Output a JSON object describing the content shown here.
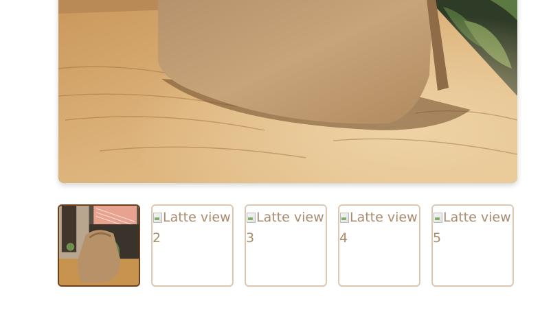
{
  "main_image": {
    "subject": "latte handbag on wooden table"
  },
  "thumbnails": [
    {
      "alt": "",
      "state": "active",
      "loaded": true
    },
    {
      "alt": "Latte view 2",
      "state": "inactive",
      "loaded": false
    },
    {
      "alt": "Latte view 3",
      "state": "inactive",
      "loaded": false
    },
    {
      "alt": "Latte view 4",
      "state": "inactive",
      "loaded": false
    },
    {
      "alt": "Latte view 5",
      "state": "inactive",
      "loaded": false
    }
  ],
  "colors": {
    "thumb_border": "#dcc8ae",
    "thumb_active_border": "#6b3f1c",
    "alt_text": "#a98b6d"
  }
}
